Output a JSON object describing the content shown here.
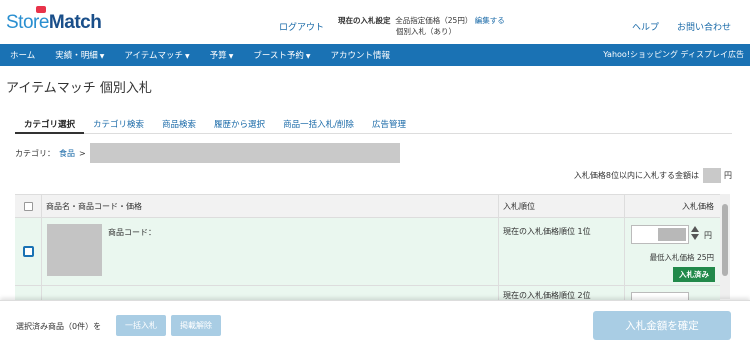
{
  "header": {
    "logo_store": "Store",
    "logo_match": "Match",
    "logout": "ログアウト",
    "bid_setting_label": "現在の入札設定",
    "bid_setting_value": "全品指定価格（25円）",
    "edit": "編集する",
    "bid_mode": "個別入札（あり）",
    "help": "ヘルプ",
    "contact": "お問い合わせ"
  },
  "nav": {
    "items": [
      "ホーム",
      "実績・明細",
      "アイテムマッチ",
      "予算",
      "ブースト予約",
      "アカウント情報"
    ],
    "right": "Yahoo!ショッピング ディスプレイ広告"
  },
  "page_title": "アイテムマッチ 個別入札",
  "tabs": [
    "カテゴリ選択",
    "カテゴリ検索",
    "商品検索",
    "履歴から選択",
    "商品一括入札/削除",
    "広告管理"
  ],
  "category": {
    "label": "カテゴリ：",
    "value": "食品",
    "separator": ">"
  },
  "note": {
    "text": "入札価格8位以内に入札する金額は",
    "unit": "円"
  },
  "table": {
    "headers": {
      "name": "商品名・商品コード・価格",
      "rank": "入札順位",
      "price": "入札価格"
    },
    "rows": [
      {
        "code_label": "商品コード：",
        "rank": "現在の入札価格順位 1位",
        "yen": "円",
        "min_bid": "最低入札価格 25円",
        "status": "入札済み"
      },
      {
        "rank": "現在の入札価格順位 2位"
      }
    ]
  },
  "footer": {
    "selected": "選択済み商品（0件）を",
    "bulk_bid": "一括入札",
    "cancel_bid": "掲載解除",
    "confirm": "入札金額を確定"
  },
  "colors": {
    "nav": "#1a72b4",
    "link": "#1a6aa8",
    "row_bg": "#eaf7ef",
    "badge": "#21894a",
    "disabled_button": "#a9cde4"
  }
}
